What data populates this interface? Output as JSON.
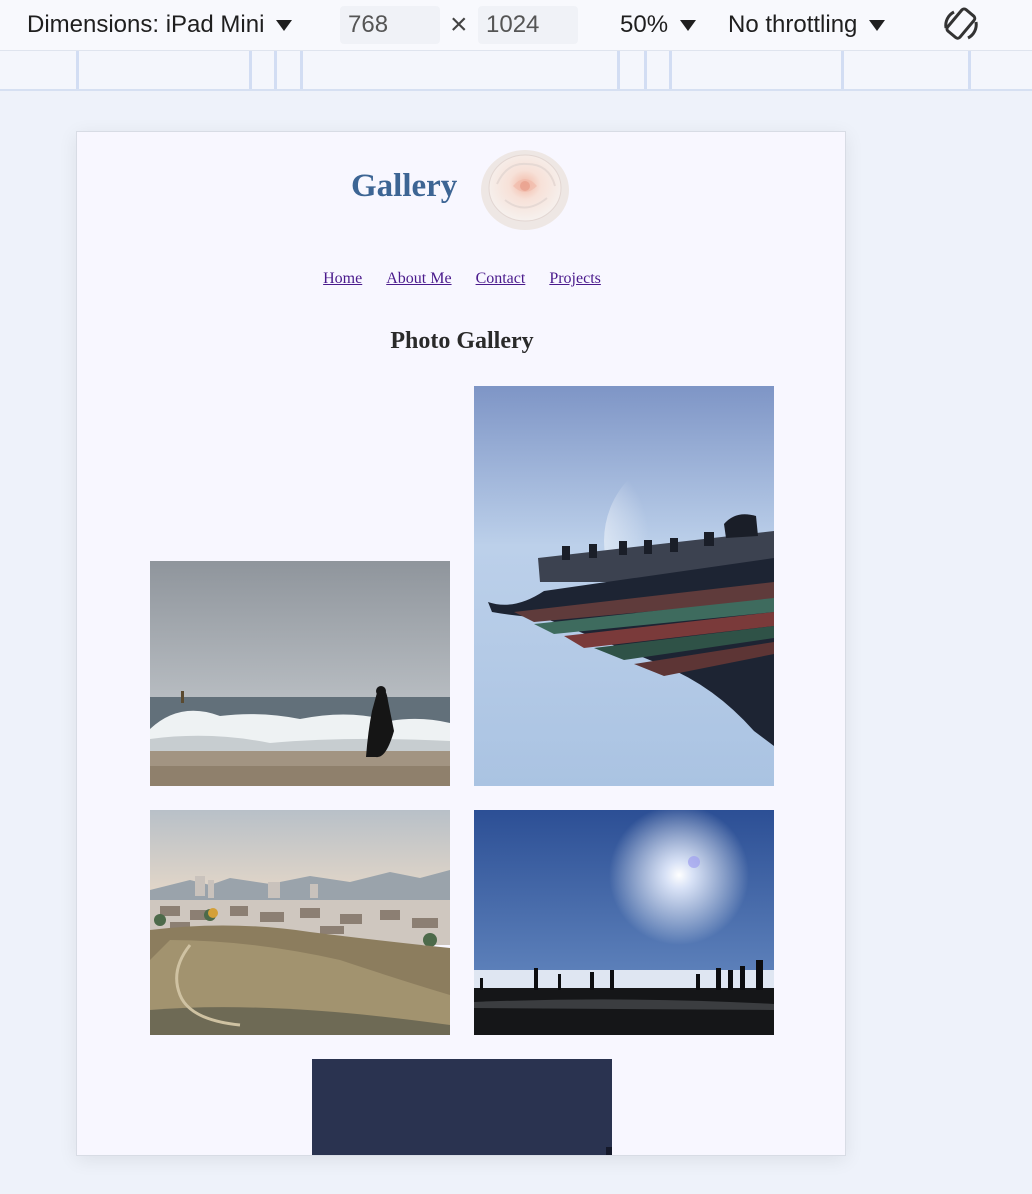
{
  "toolbar": {
    "dimensions_label": "Dimensions: iPad Mini",
    "width": "768",
    "height": "1024",
    "times": "×",
    "zoom": "50%",
    "throttling": "No throttling",
    "rotate_icon": "rotate-device-icon"
  },
  "site": {
    "title": "Gallery",
    "logo_icon": "rose-logo",
    "nav": [
      "Home",
      "About Me",
      "Contact",
      "Projects"
    ],
    "heading": "Photo Gallery"
  },
  "photos": [
    {
      "name": "beach-waves-photo"
    },
    {
      "name": "palace-roof-photo"
    },
    {
      "name": "city-view-photo"
    },
    {
      "name": "sun-silhouettes-photo"
    },
    {
      "name": "dusk-sky-photo"
    }
  ],
  "colors": {
    "title": "#3d6594",
    "link": "#4a1a8c",
    "page_bg": "#f8f7ff",
    "outer_bg": "#eef2fa"
  }
}
